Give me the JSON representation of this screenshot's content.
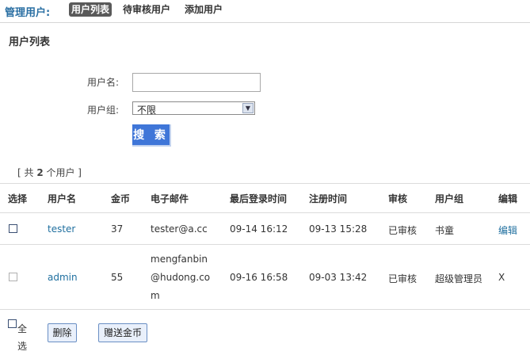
{
  "header": {
    "title": "管理用户:",
    "tabs": [
      "用户列表",
      "待审核用户",
      "添加用户"
    ]
  },
  "section_title": "用户列表",
  "search": {
    "username_label": "用户名:",
    "username_value": "",
    "group_label": "用户组:",
    "group_value": "不限",
    "button_label": "搜 索"
  },
  "count": {
    "prefix": "[ 共 ",
    "value": "2",
    "suffix": " 个用户 ]"
  },
  "table": {
    "headers": [
      "选择",
      "用户名",
      "金币",
      "电子邮件",
      "最后登录时间",
      "注册时间",
      "审核",
      "用户组",
      "编辑"
    ],
    "rows": [
      {
        "username": "tester",
        "coins": "37",
        "email_lines": [
          "tester@a.cc"
        ],
        "last_login": "09-14 16:12",
        "registered": "09-13 15:28",
        "status": "已审核",
        "group": "书童",
        "edit": "编辑"
      },
      {
        "username": "admin",
        "coins": "55",
        "email_lines": [
          "mengfanbin",
          "@hudong.co",
          "m"
        ],
        "last_login": "09-16 16:58",
        "registered": "09-03 13:42",
        "status": "已审核",
        "group": "超级管理员",
        "edit": "X"
      }
    ]
  },
  "footer": {
    "select_all": "全选",
    "delete_label": "删除",
    "gift_label": "赠送金币"
  }
}
